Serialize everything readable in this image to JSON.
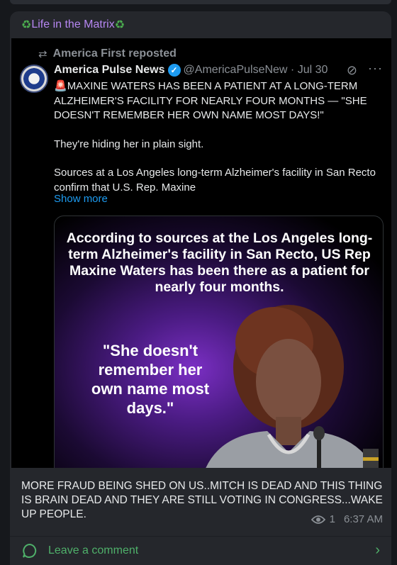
{
  "channel": {
    "title": "Life in the Matrix",
    "accent_color": "#b687f2"
  },
  "tweet": {
    "repost_by": "America First reposted",
    "author_name": "America Pulse News",
    "handle_date": "@AmericaPulseNew · Jul 30",
    "headline": "MAXINE WATERS HAS BEEN A PATIENT AT A LONG-TERM ALZHEIMER'S FACILITY FOR NEARLY FOUR MONTHS — \"SHE DOESN'T REMEMBER HER OWN NAME MOST DAYS!\"",
    "line2": "They're hiding her in plain sight.",
    "line3": "Sources at a Los Angeles long-term Alzheimer's facility in San Recto confirm that U.S. Rep. Maxine",
    "show_more": "Show more",
    "icons": {
      "repost": "repost-icon",
      "verified": "verified-badge-icon",
      "grok": "grok-icon",
      "more": "more-options-icon",
      "siren": "siren-icon"
    },
    "media": {
      "caption": "According to sources at the Los Angeles long-term Alzheimer's facility in San Recto, US Rep Maxine Waters has been there as a patient for nearly four months.",
      "quote": "\"She doesn't remember her own name most days.\""
    }
  },
  "post": {
    "text": "MORE FRAUD BEING SHED ON US..MITCH IS DEAD AND THIS THING IS BRAIN DEAD AND THEY ARE STILL VOTING IN CONGRESS...WAKE UP PEOPLE.",
    "views": "1",
    "time": "6:37 AM"
  },
  "comment": {
    "label": "Leave a comment",
    "color": "#4fb06a"
  }
}
